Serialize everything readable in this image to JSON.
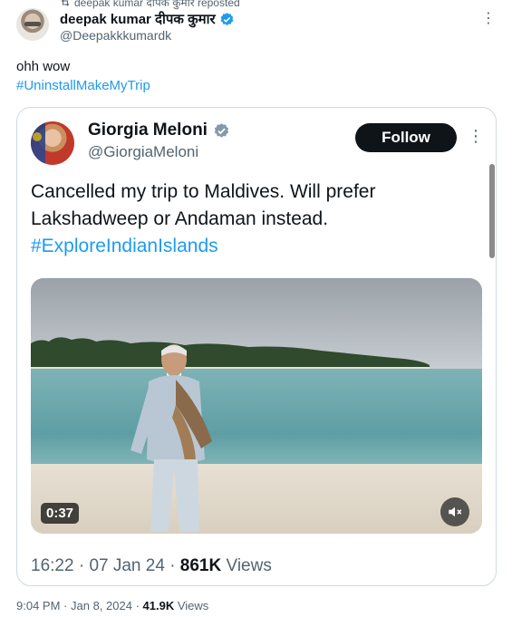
{
  "repost": {
    "text": "deepak kumar दीपक कुमार reposted"
  },
  "author": {
    "name": "deepak kumar दीपक कुमार",
    "handle": "@Deepakkkumardk",
    "more": "⋮"
  },
  "tweet": {
    "text": "ohh wow",
    "hashtag": "#UninstallMakeMyTrip"
  },
  "quoted": {
    "name": "Giorgia Meloni",
    "handle": "@GiorgiaMeloni",
    "follow_label": "Follow",
    "more": "⋮",
    "text_line1": "Cancelled my trip to Maldives. Will prefer",
    "text_line2": "Lakshadweep or Andaman instead.",
    "hashtag": "#ExploreIndianIslands",
    "video_duration": "0:37",
    "time": "16:22",
    "date": "07 Jan 24",
    "views_count": "861K",
    "views_label": "Views"
  },
  "footer": {
    "time": "9:04 PM",
    "date": "Jan 8, 2024",
    "views_count": "41.9K",
    "views_label": "Views"
  },
  "colors": {
    "accent": "#1d9bf0",
    "verified_blue": "#1d9bf0",
    "verified_grey": "#829aab",
    "text": "#0f1419",
    "secondary": "#536471",
    "border": "#cfd9de"
  },
  "icons": {
    "repost": "repost-icon",
    "verified": "verified-badge-icon",
    "more": "more-icon",
    "mute": "mute-icon"
  }
}
